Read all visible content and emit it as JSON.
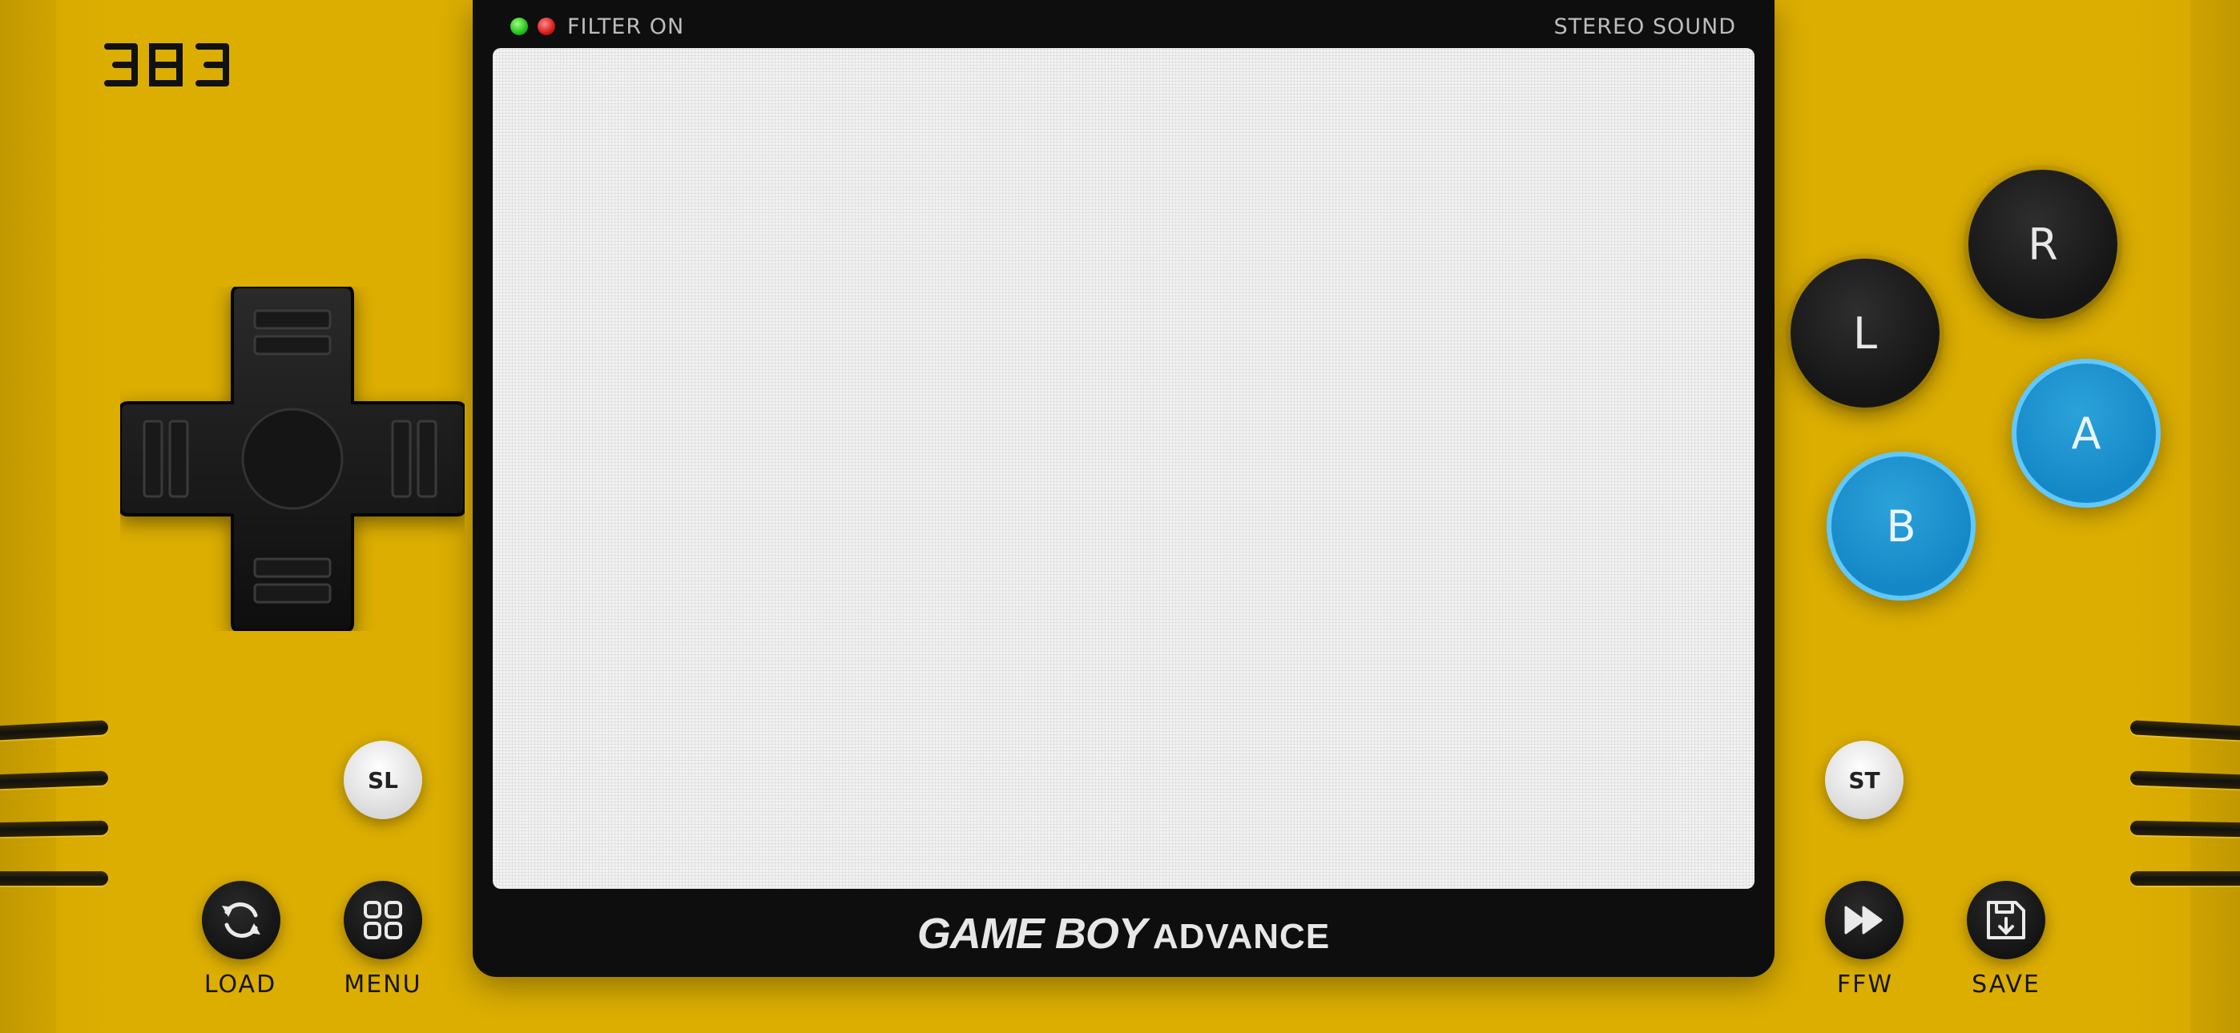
{
  "logo_text": "383",
  "console": {
    "filter_label": "FILTER ON",
    "stereo_label": "STEREO SOUND",
    "brand_main": "GAME BOY",
    "brand_sub": "ADVANCE"
  },
  "buttons": {
    "r": "R",
    "l": "L",
    "a": "A",
    "b": "B",
    "select": "SL",
    "start": "ST"
  },
  "bottom_controls": {
    "load": "LOAD",
    "menu": "MENU",
    "ffw": "FFW",
    "save": "SAVE"
  },
  "icons": {
    "load": "refresh-icon",
    "menu": "grid-icon",
    "ffw": "fast-forward-icon",
    "save": "floppy-save-icon"
  },
  "colors": {
    "body": "#dcae02",
    "console": "#0e0e0e",
    "ab_buttons": "#1488c6",
    "led_green": "#22c21d",
    "led_red": "#d81919"
  }
}
